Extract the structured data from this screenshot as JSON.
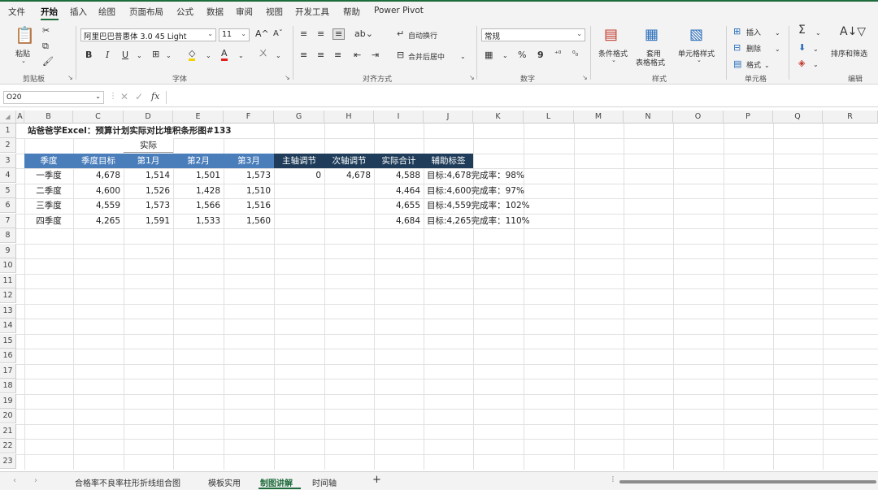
{
  "menu": {
    "items": [
      "文件",
      "开始",
      "插入",
      "绘图",
      "页面布局",
      "公式",
      "数据",
      "审阅",
      "视图",
      "开发工具",
      "帮助",
      "Power Pivot"
    ]
  },
  "ribbon": {
    "clipboard": {
      "paste": "粘贴",
      "label": "剪贴板"
    },
    "font": {
      "name": "阿里巴巴普惠体 3.0 45 Light",
      "size": "11",
      "label": "字体",
      "bold": "B",
      "italic": "I",
      "underline": "U",
      "grow": "A",
      "shrink": "A",
      "font_color_letter": "A"
    },
    "alignment": {
      "wrap": "自动换行",
      "merge": "合并后居中",
      "label": "对齐方式"
    },
    "number": {
      "format": "常规",
      "percent": "%",
      "comma": "9",
      "label": "数字"
    },
    "styles": {
      "cond": "条件格式",
      "table": "套用",
      "table2": "表格格式",
      "cell": "单元格样式",
      "label": "样式"
    },
    "cells": {
      "insert": "插入",
      "delete": "删除",
      "format": "格式",
      "label": "单元格"
    },
    "editing": {
      "sort": "排序和筛选",
      "label": "编辑",
      "sum": "Σ"
    }
  },
  "formula": {
    "cell_ref": "O20",
    "fx": "fx",
    "content": ""
  },
  "columns": [
    "A",
    "B",
    "C",
    "D",
    "E",
    "F",
    "G",
    "H",
    "I",
    "J",
    "K",
    "L",
    "M",
    "N",
    "O",
    "P",
    "Q",
    "R"
  ],
  "rows": [
    "1",
    "2",
    "3",
    "4",
    "5",
    "6",
    "7",
    "8",
    "9",
    "10",
    "11",
    "12",
    "13",
    "14",
    "15",
    "16",
    "17",
    "18",
    "19",
    "20",
    "21",
    "22",
    "23"
  ],
  "sheet": {
    "title": "站爸爸学Excel：预算计划实际对比堆积条形图#133",
    "group_label": "实际",
    "headers": [
      "季度",
      "季度目标",
      "第1月",
      "第2月",
      "第3月",
      "主轴调节",
      "次轴调节",
      "实际合计",
      "辅助标签"
    ],
    "data": [
      {
        "quarter": "一季度",
        "target": "4,678",
        "m1": "1,514",
        "m2": "1,501",
        "m3": "1,573",
        "main": "0",
        "sec": "4,678",
        "total": "4,588",
        "label": "目标:4,678完成率：98%"
      },
      {
        "quarter": "二季度",
        "target": "4,600",
        "m1": "1,526",
        "m2": "1,428",
        "m3": "1,510",
        "main": "",
        "sec": "",
        "total": "4,464",
        "label": "目标:4,600完成率：97%"
      },
      {
        "quarter": "三季度",
        "target": "4,559",
        "m1": "1,573",
        "m2": "1,566",
        "m3": "1,516",
        "main": "",
        "sec": "",
        "total": "4,655",
        "label": "目标:4,559完成率：102%"
      },
      {
        "quarter": "四季度",
        "target": "4,265",
        "m1": "1,591",
        "m2": "1,533",
        "m3": "1,560",
        "main": "",
        "sec": "",
        "total": "4,684",
        "label": "目标:4,265完成率：110%"
      }
    ]
  },
  "tabs": {
    "items": [
      "合格率不良率柱形折线组合图",
      "模板实用",
      "制图讲解",
      "时间轴"
    ],
    "active": "制图讲解",
    "add": "+"
  },
  "colors": {
    "header_blue": "#4a7ebb",
    "header_dark": "#1f3d5a",
    "accent_green": "#1e6b3c"
  }
}
